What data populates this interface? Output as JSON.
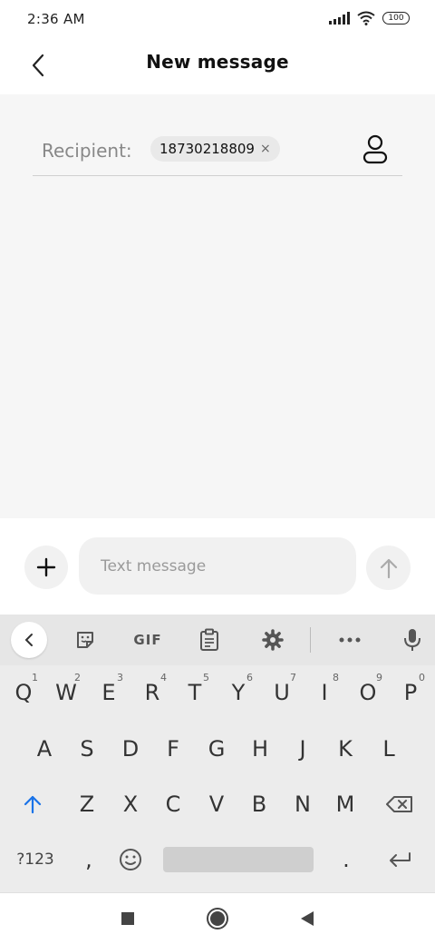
{
  "status_bar": {
    "time": "2:36 AM",
    "battery": "100"
  },
  "header": {
    "title": "New message"
  },
  "recipient": {
    "label": "Recipient:",
    "chip": "18730218809",
    "chip_close": "×"
  },
  "compose": {
    "placeholder": "Text message"
  },
  "keyboard": {
    "toolbar": {
      "gif": "GIF"
    },
    "row1": [
      {
        "key": "Q",
        "hint": "1"
      },
      {
        "key": "W",
        "hint": "2"
      },
      {
        "key": "E",
        "hint": "3"
      },
      {
        "key": "R",
        "hint": "4"
      },
      {
        "key": "T",
        "hint": "5"
      },
      {
        "key": "Y",
        "hint": "6"
      },
      {
        "key": "U",
        "hint": "7"
      },
      {
        "key": "I",
        "hint": "8"
      },
      {
        "key": "O",
        "hint": "9"
      },
      {
        "key": "P",
        "hint": "0"
      }
    ],
    "row2": [
      "A",
      "S",
      "D",
      "F",
      "G",
      "H",
      "J",
      "K",
      "L"
    ],
    "row3": [
      "Z",
      "X",
      "C",
      "V",
      "B",
      "N",
      "M"
    ],
    "row4": {
      "symbols": "?123",
      "comma": ",",
      "period": "."
    }
  },
  "colors": {
    "accent": "#1a73e8",
    "background": "#f6f6f6",
    "keyboard": "#ececec"
  }
}
